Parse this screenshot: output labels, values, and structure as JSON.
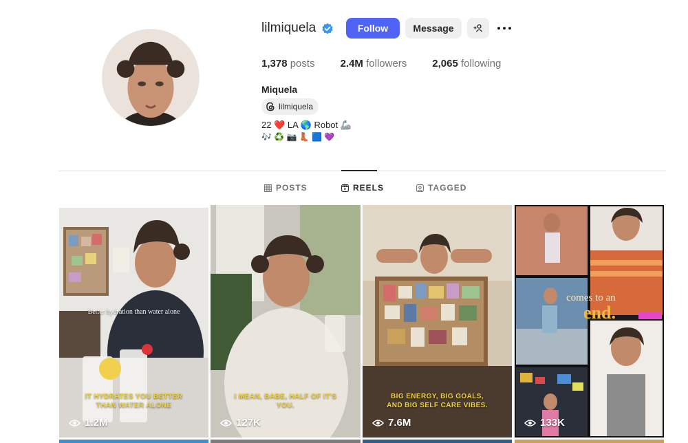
{
  "profile": {
    "username": "lilmiquela",
    "verified": true,
    "follow_label": "Follow",
    "message_label": "Message",
    "add_user_icon": "add-user-icon",
    "more_icon": "more-options-icon",
    "posts_count": "1,378",
    "posts_label": "posts",
    "followers_count": "2.4M",
    "followers_label": "followers",
    "following_count": "2,065",
    "following_label": "following",
    "full_name": "Miquela",
    "threads_handle": "lilmiquela",
    "bio_line1": "22 ❤️ LA 🌎 Robot 🦾",
    "bio_line2": "🎶 ♻️ 📷 👢 🟦 💜"
  },
  "tabs": [
    {
      "label": "POSTS",
      "icon": "grid-icon",
      "active": false
    },
    {
      "label": "REELS",
      "icon": "reels-icon",
      "active": true
    },
    {
      "label": "TAGGED",
      "icon": "tagged-icon",
      "active": false
    }
  ],
  "reels": [
    {
      "overlay": "Better hydration than water alone",
      "caption_line1": "IT HYDRATES YOU BETTER",
      "caption_line2": "THAN WATER ALONE",
      "views": "1.2M"
    },
    {
      "caption_line1": "I MEAN, BABE, HALF OF IT'S",
      "caption_line2": "YOU.",
      "views": "127K"
    },
    {
      "caption_line1": "BIG ENERGY, BIG GOALS,",
      "caption_line2": "AND BIG SELF CARE VIBES.",
      "views": "7.6M"
    },
    {
      "overlay_small": "comes to an",
      "overlay_big": "end.",
      "views": "133K"
    }
  ],
  "colors": {
    "follow_button": "#4f63f5",
    "secondary_button": "#efefef",
    "caption_yellow": "#f1d23a",
    "verified_blue": "#3897f0"
  }
}
